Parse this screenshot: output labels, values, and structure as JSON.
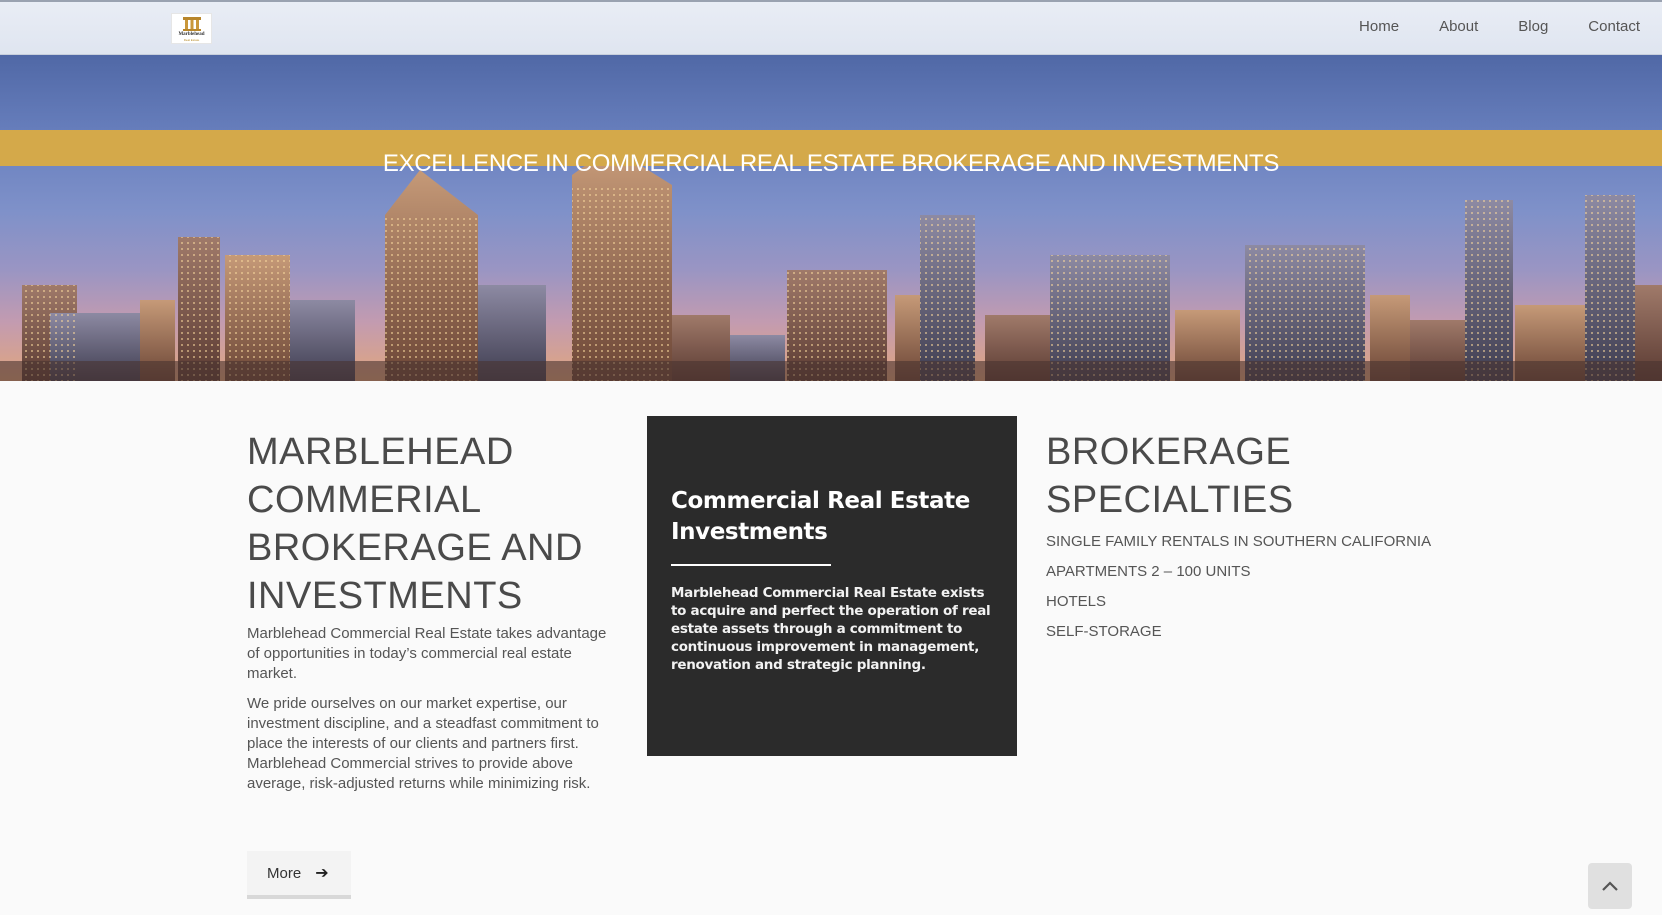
{
  "header": {
    "logo": {
      "name": "Marblehead",
      "sub": "Real Estate",
      "icon": "pillars-icon"
    },
    "nav": [
      "Home",
      "About",
      "Blog",
      "Contact"
    ]
  },
  "hero": {
    "title": "EXCELLENCE IN COMMERCIAL REAL ESTATE BROKERAGE AND INVESTMENTS",
    "banner_color": "#d4a94a"
  },
  "intro": {
    "heading": "MARBLEHEAD COMMERIAL BROKERAGE AND INVESTMENTS",
    "paragraphs": [
      "Marblehead Commercial Real Estate takes advantage of opportunities in today’s commercial real estate market.",
      "We pride ourselves on our market expertise, our investment discipline, and a steadfast commitment to place the interests of our clients and partners first. Marblehead Commercial strives to provide above average, risk-adjusted returns while minimizing risk."
    ],
    "more_label": "More",
    "more_icon": "arrow-right-icon"
  },
  "card": {
    "title": "Commercial Real Estate Investments",
    "body": "Marblehead Commercial Real Estate exists to acquire and perfect the operation of real estate assets through a commitment to continuous improvement in management, renovation and strategic planning.",
    "background": "#2b2b2b"
  },
  "specialties": {
    "heading": "BROKERAGE SPECIALTIES",
    "items": [
      "SINGLE FAMILY RENTALS IN SOUTHERN CALIFORNIA",
      "APARTMENTS 2 – 100 UNITS",
      "HOTELS",
      "SELF-STORAGE"
    ]
  },
  "scroll_top": {
    "icon": "chevron-up-icon"
  }
}
